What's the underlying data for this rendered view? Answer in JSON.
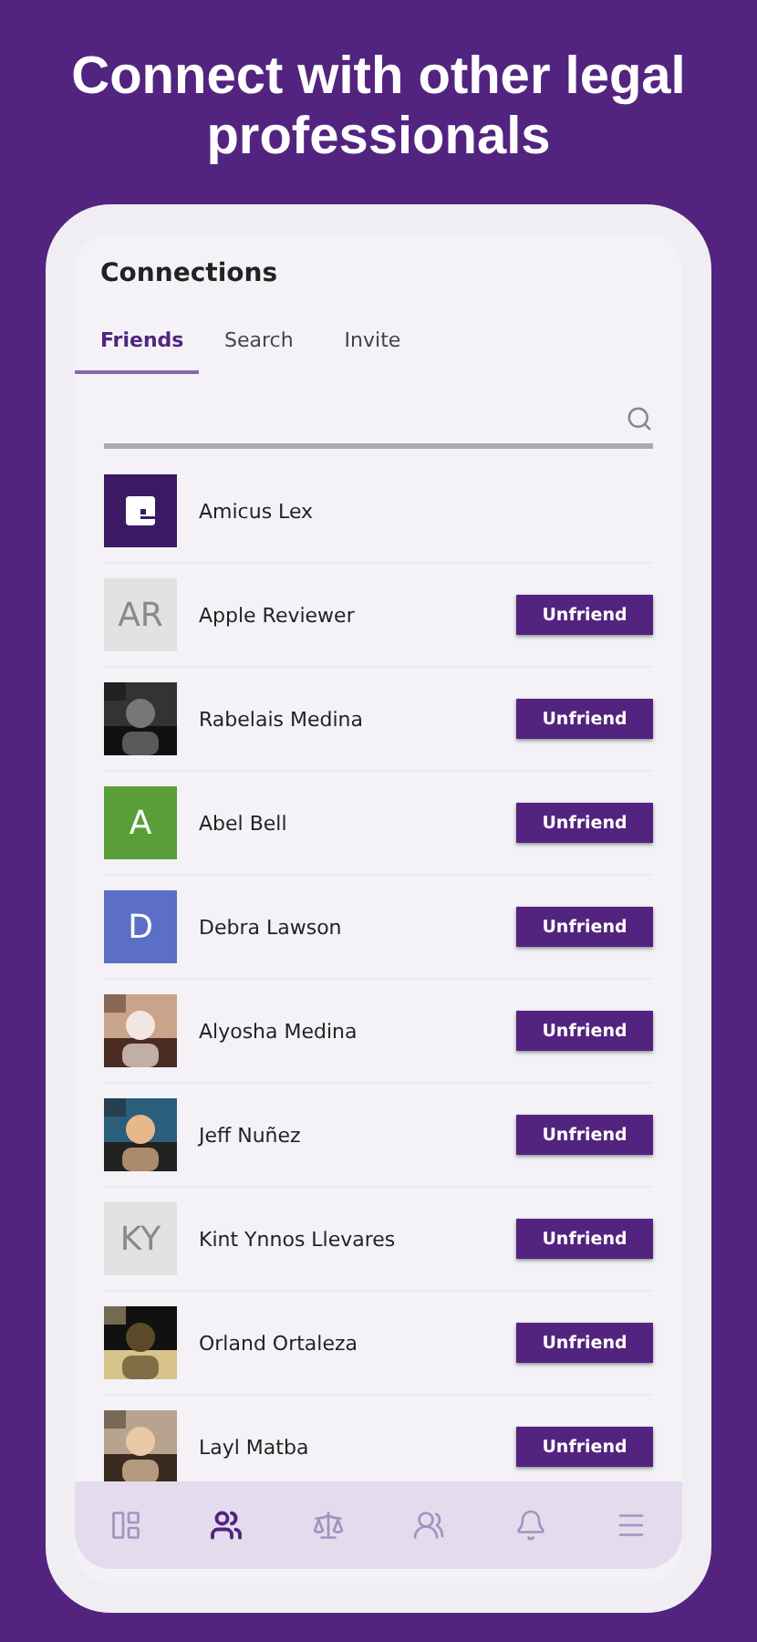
{
  "headline": "Connect with other legal professionals",
  "screen": {
    "title": "Connections",
    "tabs": [
      {
        "label": "Friends",
        "selected": true
      },
      {
        "label": "Search",
        "selected": false
      },
      {
        "label": "Invite",
        "selected": false
      }
    ],
    "connections": [
      {
        "name": "Amicus Lex",
        "avatar": {
          "kind": "logo"
        }
      },
      {
        "name": "Apple Reviewer",
        "avatar": {
          "kind": "initials",
          "text": "AR"
        },
        "action": "Unfriend"
      },
      {
        "name": "Rabelais Medina",
        "action": "Unfriend"
      },
      {
        "name": "Abel Bell",
        "avatar": {
          "kind": "letter",
          "text": "A",
          "color": "#5a9e3a"
        },
        "action": "Unfriend"
      },
      {
        "name": "Debra Lawson",
        "avatar": {
          "kind": "letter",
          "text": "D",
          "color": "#5b6fc6"
        },
        "action": "Unfriend"
      },
      {
        "name": "Alyosha Medina",
        "action": "Unfriend"
      },
      {
        "name": "Jeff Nuñez",
        "action": "Unfriend"
      },
      {
        "name": "Kint Ynnos Llevares",
        "avatar": {
          "kind": "initials",
          "text": "KY"
        },
        "action": "Unfriend"
      },
      {
        "name": "Orland Ortaleza",
        "action": "Unfriend"
      },
      {
        "name": "Layl Matba",
        "action": "Unfriend"
      }
    ],
    "nav": [
      {
        "kind": "news",
        "selected": false
      },
      {
        "kind": "friends",
        "selected": true
      },
      {
        "kind": "law",
        "selected": false
      },
      {
        "kind": "groups",
        "selected": false
      },
      {
        "kind": "alerts",
        "selected": false
      },
      {
        "kind": "menu",
        "selected": false
      }
    ]
  }
}
